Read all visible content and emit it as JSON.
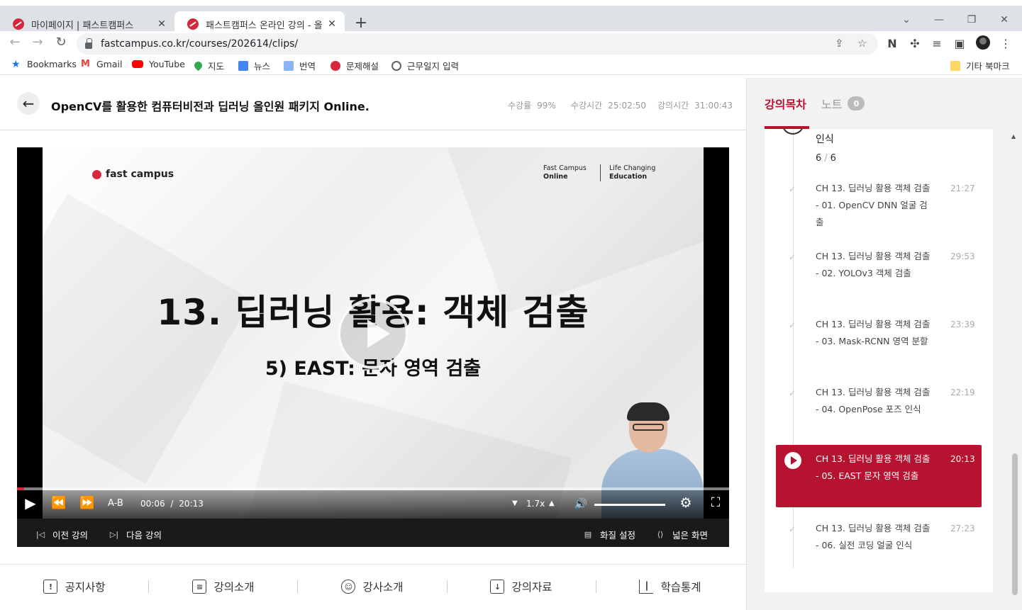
{
  "browser": {
    "tabs": [
      {
        "title": "마이페이지 | 패스트캠퍼스",
        "active": false
      },
      {
        "title": "패스트캠퍼스 온라인 강의 - 올인",
        "active": true
      }
    ],
    "url": "fastcampus.co.kr/courses/202614/clips/",
    "bookmarks": [
      {
        "label": "Bookmarks",
        "icon": "star-icon",
        "color": "#1a73e8"
      },
      {
        "label": "Gmail",
        "icon": "gmail-icon",
        "color": "#ea4335"
      },
      {
        "label": "YouTube",
        "icon": "youtube-icon",
        "color": "#ff0000"
      },
      {
        "label": "지도",
        "icon": "maps-icon",
        "color": "#34a853"
      },
      {
        "label": "뉴스",
        "icon": "news-icon",
        "color": "#4285f4"
      },
      {
        "label": "번역",
        "icon": "translate-icon",
        "color": "#4285f4"
      },
      {
        "label": "문제해설",
        "icon": "site-icon",
        "color": "#d6273f"
      },
      {
        "label": "근무일지 입력",
        "icon": "globe-icon",
        "color": "#5f6368"
      }
    ],
    "other_bookmarks": "기타 북마크"
  },
  "header": {
    "course_title": "OpenCV를 활용한 컴퓨터비전과 딥러닝 올인원 패키지 Online.",
    "stats": [
      {
        "label": "수강률",
        "value": "99%"
      },
      {
        "label": "수강시간",
        "value": "25:02:50"
      },
      {
        "label": "강의시간",
        "value": "31:00:43"
      }
    ]
  },
  "slide": {
    "logo": "fast campus",
    "brand_left_top": "Fast Campus",
    "brand_left_bottom": "Online",
    "brand_right_top": "Life Changing",
    "brand_right_bottom": "Education",
    "heading": "13. 딥러닝 활용: 객체 검출",
    "subheading": "5) EAST: 문자 영역 검출"
  },
  "player": {
    "progress": 0.005,
    "ab_label": "A-B",
    "current_time": "00:06",
    "time_sep": "/",
    "duration": "20:13",
    "speed": "1.7x",
    "prev_label": "이전 강의",
    "next_label": "다음 강의",
    "quality_label": "화질 설정",
    "wide_label": "넓은 화면"
  },
  "bottom_tabs": [
    {
      "label": "공지사항",
      "icon": "notice-icon"
    },
    {
      "label": "강의소개",
      "icon": "clipboard-icon"
    },
    {
      "label": "강사소개",
      "icon": "user-icon"
    },
    {
      "label": "강의자료",
      "icon": "download-icon"
    },
    {
      "label": "학습통계",
      "icon": "stats-icon"
    }
  ],
  "sidebar": {
    "tab_toc": "강의목차",
    "tab_notes": "노트",
    "notes_count": "0",
    "chapter_tail": "인식",
    "chapter_done": "6",
    "chapter_total": "6",
    "lessons": [
      {
        "title": "CH 13. 딥러닝 활용 객체 검출 - 01. OpenCV DNN 얼굴 검출",
        "time": "21:27",
        "active": false
      },
      {
        "title": "CH 13. 딥러닝 활용 객체 검출 - 02. YOLOv3 객체 검출",
        "time": "29:53",
        "active": false
      },
      {
        "title": "CH 13. 딥러닝 활용 객체 검출 - 03. Mask-RCNN 영역 분할",
        "time": "23:39",
        "active": false
      },
      {
        "title": "CH 13. 딥러닝 활용 객체 검출 - 04. OpenPose 포즈 인식",
        "time": "22:19",
        "active": false
      },
      {
        "title": "CH 13. 딥러닝 활용 객체 검출 - 05. EAST 문자 영역 검출",
        "time": "20:13",
        "active": true
      },
      {
        "title": "CH 13. 딥러닝 활용 객체 검출 - 06. 실전 코딩 얼굴 인식",
        "time": "27:23",
        "active": false
      }
    ]
  },
  "colors": {
    "brand": "#b5132f",
    "progress": "#d6273f"
  }
}
